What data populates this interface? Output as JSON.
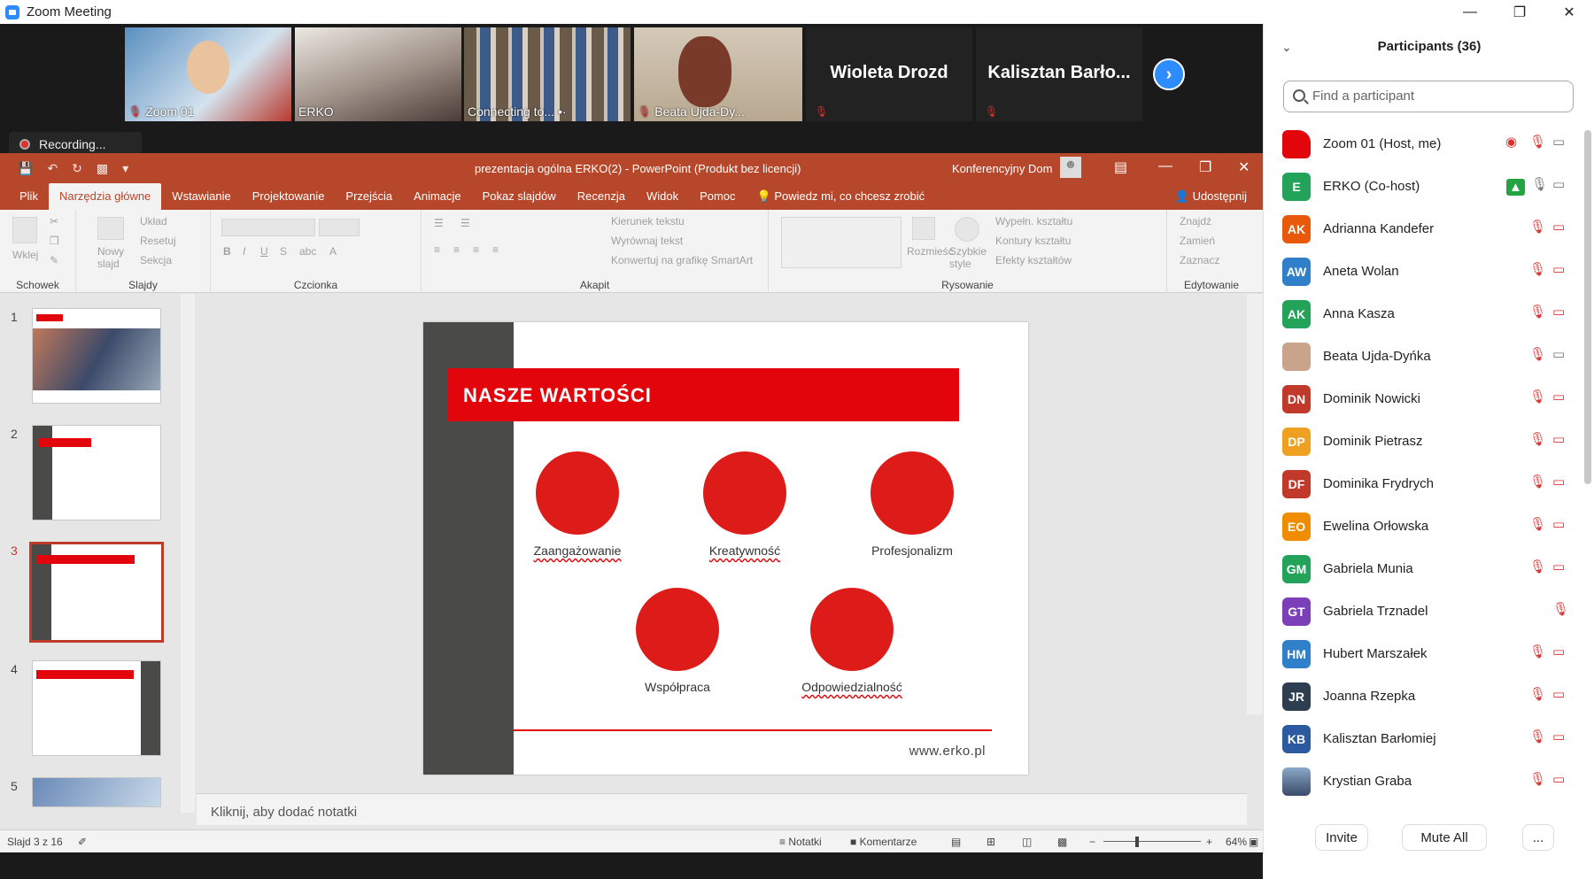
{
  "window": {
    "title": "Zoom Meeting"
  },
  "thumbs": [
    {
      "name": "Zoom 01"
    },
    {
      "name": "ERKO"
    },
    {
      "name": "Connecting to..."
    },
    {
      "name": "Beata Ujda-Dy..."
    }
  ],
  "name_tiles": [
    "Wioleta Drozd",
    "Kalisztan  Barło..."
  ],
  "recording": "Recording...",
  "ppt": {
    "doc_title": "prezentacja ogólna ERKO(2)  -  PowerPoint (Produkt bez licencji)",
    "user": "Konferencyjny Dom",
    "tabs": [
      "Plik",
      "Narzędzia główne",
      "Wstawianie",
      "Projektowanie",
      "Przejścia",
      "Animacje",
      "Pokaz slajdów",
      "Recenzja",
      "Widok",
      "Pomoc"
    ],
    "active_tab": 1,
    "tell_me": "Powiedz mi, co chcesz zrobić",
    "share": "Udostępnij",
    "groups": [
      "Schowek",
      "Slajdy",
      "Czcionka",
      "Akapit",
      "Rysowanie",
      "Edytowanie"
    ],
    "ribbon": {
      "paste": "Wklej",
      "new_slide": "Nowy slajd",
      "layout": "Układ",
      "reset": "Resetuj",
      "section": "Sekcja",
      "text_dir": "Kierunek tekstu",
      "align_text": "Wyrównaj tekst",
      "smartart": "Konwertuj na grafikę SmartArt",
      "arrange": "Rozmieść",
      "quick_styles": "Szybkie style",
      "fill": "Wypełn. kształtu",
      "outline": "Kontury kształtu",
      "effects": "Efekty kształtów",
      "find": "Znajdź",
      "replace": "Zamień",
      "select": "Zaznacz"
    },
    "slide": {
      "heading": "NASZE WARTOŚCI",
      "values": [
        "Zaangażowanie",
        "Kreatywność",
        "Profesjonalizm",
        "Współpraca",
        "Odpowiedzialność"
      ],
      "url": "www.erko.pl"
    },
    "slide_numbers": [
      "1",
      "2",
      "3",
      "4",
      "5"
    ],
    "notes_placeholder": "Kliknij, aby dodać notatki",
    "status": {
      "slide_info": "Slajd 3 z 16",
      "notes": "Notatki",
      "comments": "Komentarze",
      "zoom": "64%"
    }
  },
  "participants": {
    "title": "Participants (36)",
    "search_placeholder": "Find a participant",
    "list": [
      {
        "initials": "",
        "name": "Zoom 01 (Host, me)",
        "color": "#e3050c"
      },
      {
        "initials": "E",
        "name": "ERKO (Co-host)",
        "color": "#23a359"
      },
      {
        "initials": "AK",
        "name": "Adrianna Kandefer",
        "color": "#e8590c"
      },
      {
        "initials": "AW",
        "name": "Aneta Wolan",
        "color": "#2f80c9"
      },
      {
        "initials": "AK",
        "name": "Anna Kasza",
        "color": "#23a359"
      },
      {
        "initials": "",
        "name": "Beata Ujda-Dyńka",
        "color": "#c9a38a"
      },
      {
        "initials": "DN",
        "name": "Dominik Nowicki",
        "color": "#c0392b"
      },
      {
        "initials": "DP",
        "name": "Dominik Pietrasz",
        "color": "#f0a020"
      },
      {
        "initials": "DF",
        "name": "Dominika Frydrych",
        "color": "#c0392b"
      },
      {
        "initials": "EO",
        "name": "Ewelina Orłowska",
        "color": "#f08c00"
      },
      {
        "initials": "GM",
        "name": "Gabriela Munia",
        "color": "#23a359"
      },
      {
        "initials": "GT",
        "name": "Gabriela Trznadel",
        "color": "#7b3fb8"
      },
      {
        "initials": "HM",
        "name": "Hubert Marszałek",
        "color": "#2f80c9"
      },
      {
        "initials": "JR",
        "name": "Joanna Rzepka",
        "color": "#2c3e50"
      },
      {
        "initials": "KB",
        "name": "Kalisztan Barłomiej",
        "color": "#2c5aa0"
      },
      {
        "initials": "",
        "name": "Krystian Graba",
        "color": "#4a6fa5"
      }
    ],
    "invite": "Invite",
    "mute_all": "Mute All",
    "more": "..."
  }
}
